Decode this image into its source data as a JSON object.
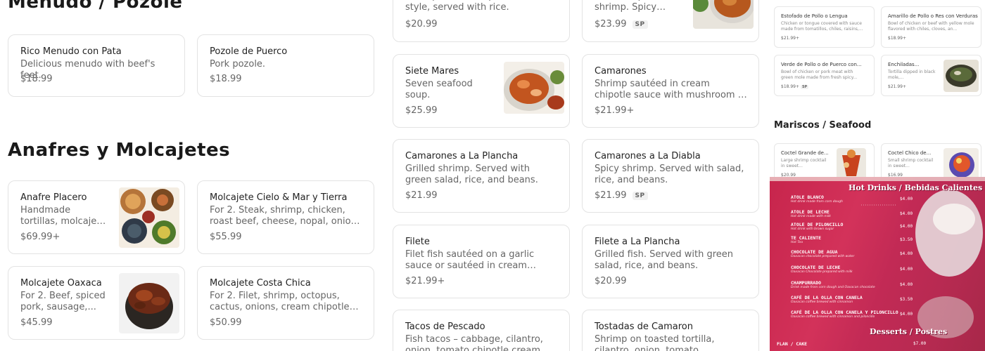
{
  "sections": {
    "menudo_title": "Menudo / Pozole",
    "anafres_title": "Anafres y Molcajetes"
  },
  "menudo": [
    {
      "name": "Rico Menudo con Pata",
      "desc": "Delicious menudo with beef's feet.",
      "price": "$18.99"
    },
    {
      "name": "Pozole de Puerco",
      "desc": "Pork pozole.",
      "price": "$18.99"
    }
  ],
  "anafres": [
    {
      "name": "Anafre Placero",
      "desc": "Handmade tortillas, molcajete sauce,...",
      "price": "$69.99+"
    },
    {
      "name": "Molcajete Cielo & Mar y Tierra",
      "desc": "For 2. Steak, shrimp, chicken, roast beef, cheese, nopal, onions bathed i...",
      "price": "$55.99"
    },
    {
      "name": "Molcajete Oaxaca",
      "desc": "For 2. Beef, spiced pork, sausage,...",
      "price": "$45.99"
    },
    {
      "name": "Molcajete Costa Chica",
      "desc": "For 2. Filet, shrimp, octopus, cactus, onions, cream chipotle sauce, and...",
      "price": "$50.99"
    }
  ],
  "seafood": {
    "top_left": {
      "desc": "Shrimp or fish soup, seaside style, served with rice.",
      "price": "$20.99"
    },
    "top_right": {
      "desc": "Fish, octopus, and shrimp. Spicy soup.",
      "price": "$23.99",
      "badge": "SP"
    },
    "items": [
      {
        "name": "Siete Mares",
        "desc": "Seven seafood soup.",
        "price": "$25.99"
      },
      {
        "name": "Camarones",
        "desc": "Shrimp sautéed in cream chipotle sauce with mushroom or garlic sauc...",
        "price": "$21.99+"
      },
      {
        "name": "Camarones a La Plancha",
        "desc": "Grilled shrimp. Served with green salad, rice, and beans.",
        "price": "$21.99"
      },
      {
        "name": "Camarones a La Diabla",
        "desc": "Spicy shrimp. Served with salad, rice, and beans.",
        "price": "$21.99",
        "badge": "SP"
      },
      {
        "name": "Filete",
        "desc": "Filet fish sautéed on a garlic sauce or sautéed in cream chipotle sauce wit...",
        "price": "$21.99+"
      },
      {
        "name": "Filete a La Plancha",
        "desc": "Grilled fish. Served with green salad, rice, and beans.",
        "price": "$20.99"
      },
      {
        "name": "Tacos de Pescado",
        "desc": "Fish tacos – cabbage, cilantro, onion, tomato chipotle cream dressing..."
      },
      {
        "name": "Tostadas de Camaron",
        "desc": "Shrimp on toasted tortilla, cilantro, onion, tomato, avocado..."
      }
    ]
  },
  "mini": {
    "section_title": "Mariscos / Seafood",
    "items": [
      {
        "name": "Estofado de Pollo o Lengua",
        "desc": "Chicken or tongue covered with sauce made from tomatillos, chiles, raisins,...",
        "price": "$21.99+"
      },
      {
        "name": "Amarillo de Pollo o Res con Verduras",
        "desc": "Bowl of chicken or beef with yellow mole flavored with chiles, cloves, an...",
        "price": "$18.99+"
      },
      {
        "name": "Verde de Pollo o de Puerco con...",
        "desc": "Bowl of chicken or pork meat with green mole made from fresh spicy...",
        "price": "$18.99+",
        "badge": "SP"
      },
      {
        "name": "Enchiladas...",
        "desc": "Tortilla dipped in black mole,...",
        "price": "$21.99+"
      },
      {
        "name": "Coctel Grande de...",
        "desc": "Large shrimp cocktail in sweet...",
        "price": "$20.99"
      },
      {
        "name": "Coctel Chico de...",
        "desc": "Small shrimp cocktail in sweet...",
        "price": "$16.99"
      }
    ]
  },
  "menu_photo": {
    "hot_drinks_title": "Hot Drinks / Bebidas Calientes",
    "desserts_title": "Desserts / Postres",
    "rows": [
      {
        "name": "ATOLE BLANCO",
        "sub": "Hot drink made from corn dough",
        "price": "$4.00"
      },
      {
        "name": "ATOLE DE LECHE",
        "sub": "Hot drink made with milk",
        "price": "$4.00"
      },
      {
        "name": "ATOLE DE PILONCILLO",
        "sub": "Hot drink with brown sugar",
        "price": "$4.00"
      },
      {
        "name": "TE CALIENTE",
        "sub": "Hot Tea",
        "price": "$3.50"
      },
      {
        "name": "CHOCOLATE DE AGUA",
        "sub": "Oaxacan chocolate prepared with water",
        "price": "$4.00"
      },
      {
        "name": "CHOCOLATE DE LECHE",
        "sub": "Oaxacan Chocolate prepared with milk",
        "price": "$4.00"
      },
      {
        "name": "CHAMPURRADO",
        "sub": "Drink made from corn dough and Oaxacan chocolate",
        "price": "$4.00"
      },
      {
        "name": "CAFÉ DE LA OLLA CON CANELA",
        "sub": "Oaxacan coffee brewed with cinnamon",
        "price": "$3.50"
      },
      {
        "name": "CAFÉ DE LA OLLA CON CANELA Y PILONCILLO",
        "sub": "Oaxacan coffee brewed with cinnamon and piloncillo",
        "price": "$4.00"
      }
    ],
    "dessert_row": {
      "name": "FLAN / CAKE",
      "price": "$7.00"
    }
  }
}
